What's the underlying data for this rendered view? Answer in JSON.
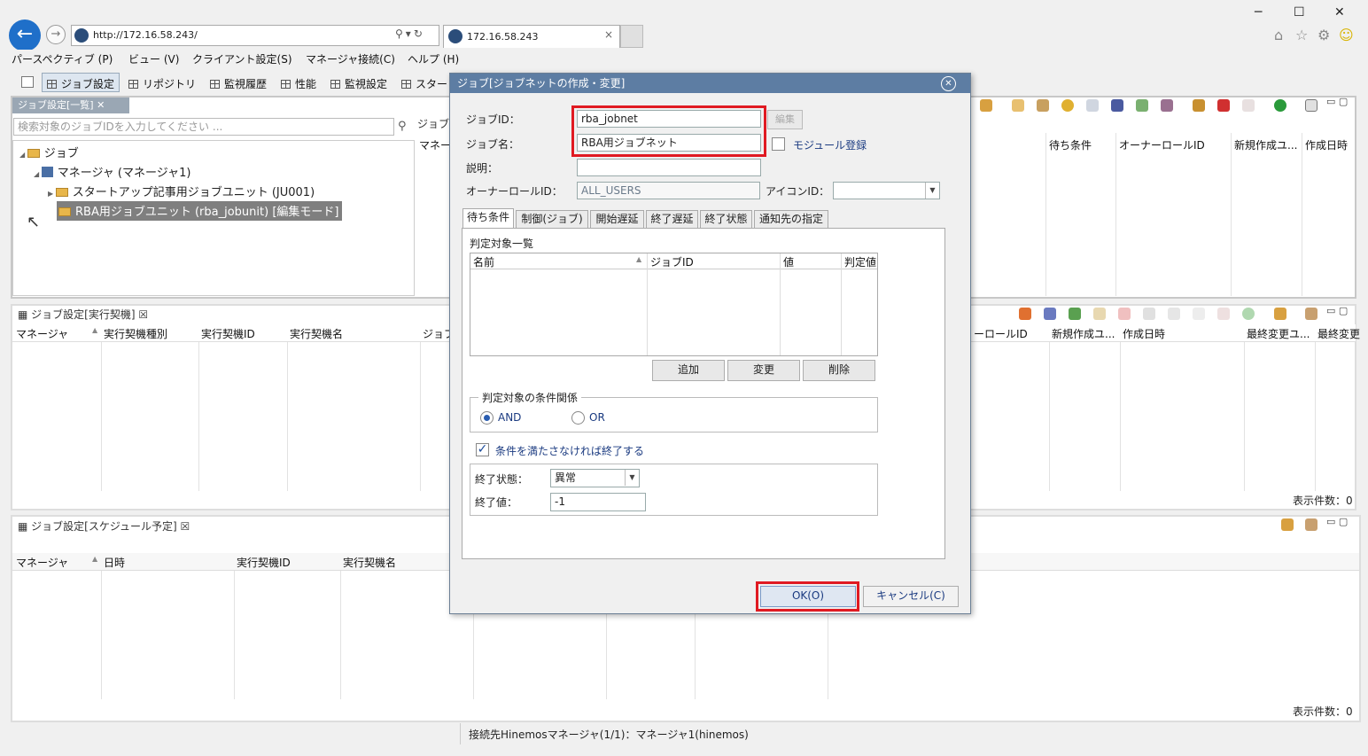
{
  "browser": {
    "url": "http://172.16.58.243/",
    "tab_title": "172.16.58.243",
    "tab_close": "×",
    "win_min": "─",
    "win_max": "☐",
    "win_close": "✕"
  },
  "menu": [
    "パースペクティブ (P)",
    "ビュー (V)",
    "クライアント設定(S)",
    "マネージャ接続(C)",
    "ヘルプ (H)"
  ],
  "toolbar": [
    "ジョブ設定",
    "リポジトリ",
    "監視履歴",
    "性能",
    "監視設定",
    "スター"
  ],
  "job_list_view": {
    "tab": "ジョブ設定[一覧]",
    "tab2": "ジョブ",
    "search_placeholder": "検索対象のジョブIDを入力してください ...",
    "col_mgr": "マネー",
    "columns": [
      "待ち条件",
      "オーナーロールID",
      "新規作成ユ...",
      "作成日時"
    ],
    "tree": {
      "root": "ジョブ",
      "manager": "マネージャ (マネージャ1)",
      "unit1": "スタートアップ記事用ジョブユニット (JU001)",
      "unit2": "RBA用ジョブユニット (rba_jobunit) [編集モード]"
    }
  },
  "trigger_view": {
    "tab": "ジョブ設定[実行契機]",
    "columns_left": [
      "マネージャ",
      "実行契機種別",
      "実行契機ID",
      "実行契機名",
      "ジョブ"
    ],
    "columns_right": [
      "ーロールID",
      "新規作成ユ...",
      "作成日時",
      "最終変更ユ...",
      "最終変更"
    ],
    "count": "表示件数：0"
  },
  "schedule_view": {
    "tab": "ジョブ設定[スケジュール予定]",
    "columns": [
      "マネージャ",
      "日時",
      "実行契機ID",
      "実行契機名"
    ],
    "count": "表示件数：0"
  },
  "status_bar": "接続先Hinemosマネージャ(1/1)：マネージャ1(hinemos)",
  "dialog": {
    "title": "ジョブ[ジョブネットの作成・変更]",
    "job_id_label": "ジョブID：",
    "job_id_value": "rba_jobnet",
    "edit_button": "編集",
    "job_name_label": "ジョブ名：",
    "job_name_value": "RBA用ジョブネット",
    "module_label": "モジュール登録",
    "desc_label": "説明：",
    "desc_value": "",
    "owner_label": "オーナーロールID：",
    "owner_value": "ALL_USERS",
    "icon_label": "アイコンID：",
    "icon_value": "",
    "tabs": [
      "待ち条件",
      "制御(ジョブ)",
      "開始遅延",
      "終了遅延",
      "終了状態",
      "通知先の指定"
    ],
    "judge_list_label": "判定対象一覧",
    "judge_columns": [
      "名前",
      "ジョブID",
      "値",
      "判定値"
    ],
    "add_button": "追加",
    "modify_button": "変更",
    "delete_button": "削除",
    "condition_group": "判定対象の条件関係",
    "and_label": "AND",
    "or_label": "OR",
    "end_if_unmet_label": "条件を満たさなければ終了する",
    "end_status_label": "終了状態：",
    "end_status_value": "異常",
    "end_value_label": "終了値：",
    "end_value": "-1",
    "ok_button": "OK(O)",
    "cancel_button": "キャンセル(C)"
  }
}
